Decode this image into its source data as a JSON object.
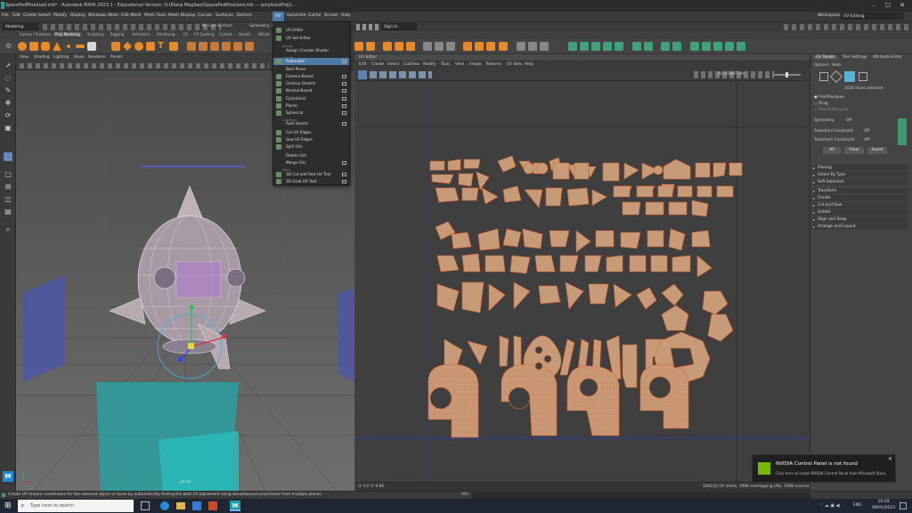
{
  "title_bar": {
    "title": "SpacePodFinalised.mb* - Autodesk MAYA 2023.1 - Educational Version: D:\\Elana Magliaei\\SpacePodfinalised.mb --- polyAutoProj1...",
    "minimize": "–",
    "maximize": "☐",
    "close": "✕"
  },
  "menubar": {
    "items": [
      "File",
      "Edit",
      "Create",
      "Select",
      "Modify",
      "Display",
      "Windows",
      "Mesh",
      "Edit Mesh",
      "Mesh Tools",
      "Mesh Display",
      "Curves",
      "Surfaces",
      "Deform",
      "UV",
      "Generate",
      "Cache",
      "Arnold",
      "Help"
    ],
    "selected": "UV",
    "workspace_label": "Workspace:",
    "workspace_value": "UV Editing"
  },
  "status_line": {
    "mode": "Modeling",
    "no_live_surface": "No Live Surface",
    "symmetry": "Symmetry: Off",
    "sign_in": "Sign In"
  },
  "shelf_tabs": {
    "tabs": [
      "Curves / Surfaces",
      "Poly Modeling",
      "Sculpting",
      "Rigging",
      "Animation",
      "Rendering",
      "FX",
      "FX Caching",
      "Custom",
      "Arnold",
      "Bifrost"
    ],
    "active": "Poly Modeling"
  },
  "viewport": {
    "menu": [
      "View",
      "Shading",
      "Lighting",
      "Show",
      "Renderer",
      "Panels"
    ],
    "camera": "persp"
  },
  "uv_menu": {
    "items": [
      {
        "label": "UV Editor",
        "type": "item",
        "option": false
      },
      {
        "label": "UV Set Editor",
        "type": "item",
        "option": false
      },
      {
        "label": "Assign",
        "type": "section"
      },
      {
        "label": "Assign Checker Shader",
        "type": "item",
        "option": false
      },
      {
        "label": "Create",
        "type": "section"
      },
      {
        "label": "Automatic",
        "type": "item",
        "option": true,
        "highlight": true
      },
      {
        "label": "Best Plane",
        "type": "item",
        "option": false
      },
      {
        "label": "Camera-Based",
        "type": "item",
        "option": true
      },
      {
        "label": "Contour Stretch",
        "type": "item",
        "option": true
      },
      {
        "label": "Normal-Based",
        "type": "item",
        "option": true
      },
      {
        "label": "Cylindrical",
        "type": "item",
        "option": true
      },
      {
        "label": "Planar",
        "type": "item",
        "option": true
      },
      {
        "label": "Spherical",
        "type": "item",
        "option": true
      },
      {
        "label": "Cut/Sew",
        "type": "section"
      },
      {
        "label": "Auto Seams",
        "type": "item",
        "option": true
      },
      {
        "label": "Cut UV Edges",
        "type": "item",
        "option": false
      },
      {
        "label": "Sew UV Edges",
        "type": "item",
        "option": false
      },
      {
        "label": "Split UVs",
        "type": "item",
        "option": false
      },
      {
        "label": "Delete UVs",
        "type": "item",
        "option": false
      },
      {
        "label": "Merge UVs",
        "type": "item",
        "option": true
      },
      {
        "label": "Tools",
        "type": "section"
      },
      {
        "label": "3D Cut and Sew UV Tool",
        "type": "item",
        "option": true
      },
      {
        "label": "3D Grab UV Tool",
        "type": "item",
        "option": true
      }
    ]
  },
  "uv_editor": {
    "title": "UV Editor",
    "menu": [
      "Edit",
      "Create",
      "Select",
      "Cut/Sew",
      "Modify",
      "Tools",
      "View",
      "Image",
      "Textures",
      "UV Sets",
      "Help"
    ],
    "no_udim": "No UDIM/Tiles",
    "status_left": "U: 0.0  V: 0.66",
    "status_right": "1901(0) UV shells, 1998 overlapping UVs, 1998 reversed faces"
  },
  "uv_toolkit": {
    "tabs": [
      "UV Toolkit",
      "Tool Settings",
      "Attribute Editor"
    ],
    "menu": [
      "Options",
      "Help"
    ],
    "selection_info": "1026 faces selected",
    "radio": [
      "Pick/Marquee",
      "Drag",
      "Tweak/Marquee"
    ],
    "symmetry_label": "Symmetry:",
    "symmetry_value": "Off",
    "selection_constraint_label": "Selection Constraint:",
    "selection_constraint_value": "Off",
    "transform_constraint_label": "Transform Constraint:",
    "transform_constraint_value": "Off",
    "buttons": [
      "All",
      "Clear",
      "Invert"
    ],
    "sections": [
      "Pinning",
      "Select By Type",
      "Soft Selection",
      "Transform",
      "Create",
      "Cut and Sew",
      "Unfold",
      "Align and Snap",
      "Arrange and Layout"
    ],
    "uv_sets": "UV Sets"
  },
  "help_line": "Create UV texture coordinates for the selected object or faces by automatically finding the best UV placement using simultaneous projections from multiple planes",
  "notification": {
    "title": "NVIDIA Control Panel is not found",
    "body": "Click here to install NVIDIA Control Panel from Microsoft Store."
  },
  "taskbar": {
    "search_placeholder": "Type here to search",
    "language": "ENG",
    "time": "10:29",
    "date": "08/05/2023"
  },
  "colors": {
    "uv_fill": "#c79a78",
    "uv_edge": "#e2622a",
    "menu_highlight": "#4d7aa6",
    "shelf_accent": "#e88a2a"
  }
}
